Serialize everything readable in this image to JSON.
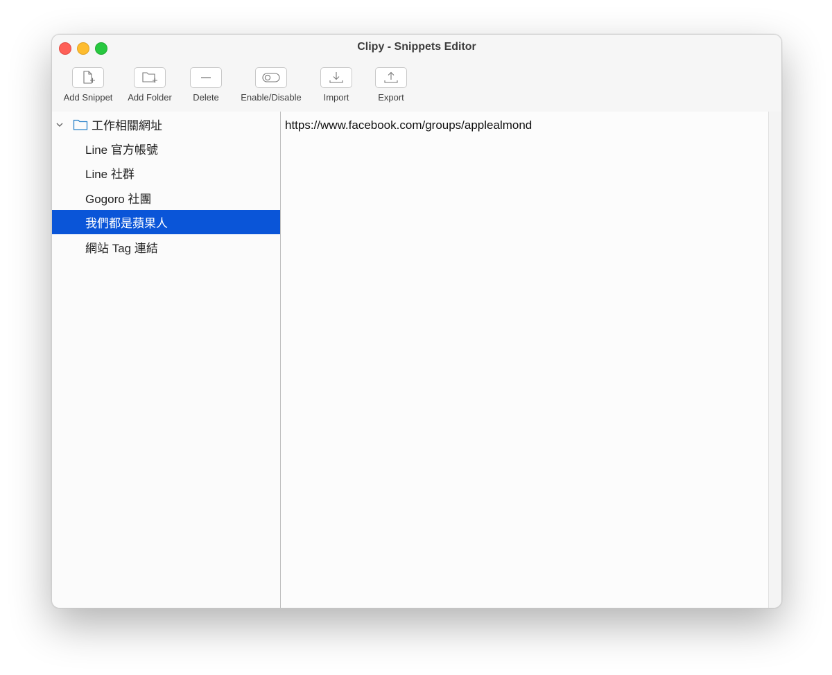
{
  "window": {
    "title": "Clipy - Snippets Editor"
  },
  "toolbar": {
    "add_snippet": "Add Snippet",
    "add_folder": "Add Folder",
    "delete": "Delete",
    "enable_disable": "Enable/Disable",
    "import": "Import",
    "export": "Export"
  },
  "sidebar": {
    "folder": {
      "name": "工作相關網址",
      "expanded": true
    },
    "items": [
      {
        "label": "Line 官方帳號"
      },
      {
        "label": "Line 社群"
      },
      {
        "label": "Gogoro 社團"
      },
      {
        "label": "我們都是蘋果人",
        "selected": true
      },
      {
        "label": "網站 Tag 連結"
      }
    ]
  },
  "editor": {
    "content": "https://www.facebook.com/groups/applealmond"
  },
  "colors": {
    "selection": "#0a55d8",
    "close": "#fe5f57",
    "minimize": "#febc2e",
    "maximize": "#28c840",
    "folder_icon": "#2a82c9"
  }
}
